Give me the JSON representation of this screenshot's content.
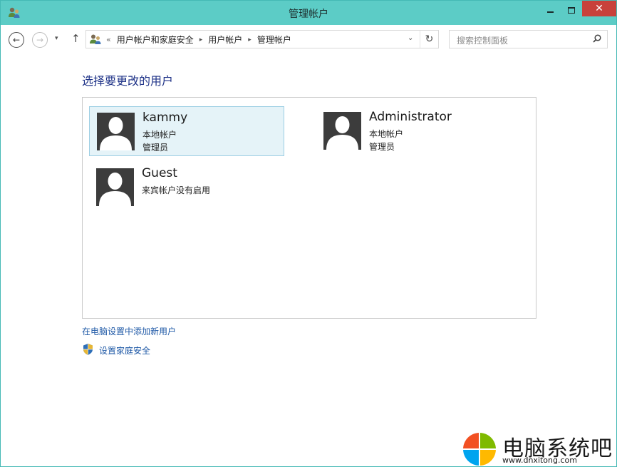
{
  "window": {
    "title": "管理帐户",
    "close_label": "✕"
  },
  "nav": {
    "back": "←",
    "forward": "→",
    "recent": "▾",
    "up": "↑",
    "overflow": "«",
    "breadcrumbs": [
      "用户帐户和家庭安全",
      "用户帐户",
      "管理帐户"
    ],
    "crumb_sep": "▸",
    "dropdown": "⌄",
    "refresh": "↻",
    "search_placeholder": "搜索控制面板"
  },
  "content": {
    "heading": "选择要更改的用户",
    "users": [
      {
        "name": "kammy",
        "line1": "本地帐户",
        "line2": "管理员",
        "selected": true
      },
      {
        "name": "Administrator",
        "line1": "本地帐户",
        "line2": "管理员",
        "selected": false
      },
      {
        "name": "Guest",
        "line1": "来宾帐户没有启用",
        "line2": "",
        "selected": false
      }
    ],
    "add_user_link": "在电脑设置中添加新用户",
    "family_safety_link": "设置家庭安全"
  },
  "watermark": {
    "text": "电脑系统吧",
    "url": "www.dnxitong.com",
    "colors": [
      "#f25022",
      "#7fba00",
      "#00a4ef",
      "#ffb900"
    ]
  },
  "colors": {
    "titlebar": "#5cccc6",
    "heading": "#1e3287",
    "link": "#1e58a6",
    "selected_tile": "#e5f3f8",
    "close_button": "#c8413b"
  }
}
